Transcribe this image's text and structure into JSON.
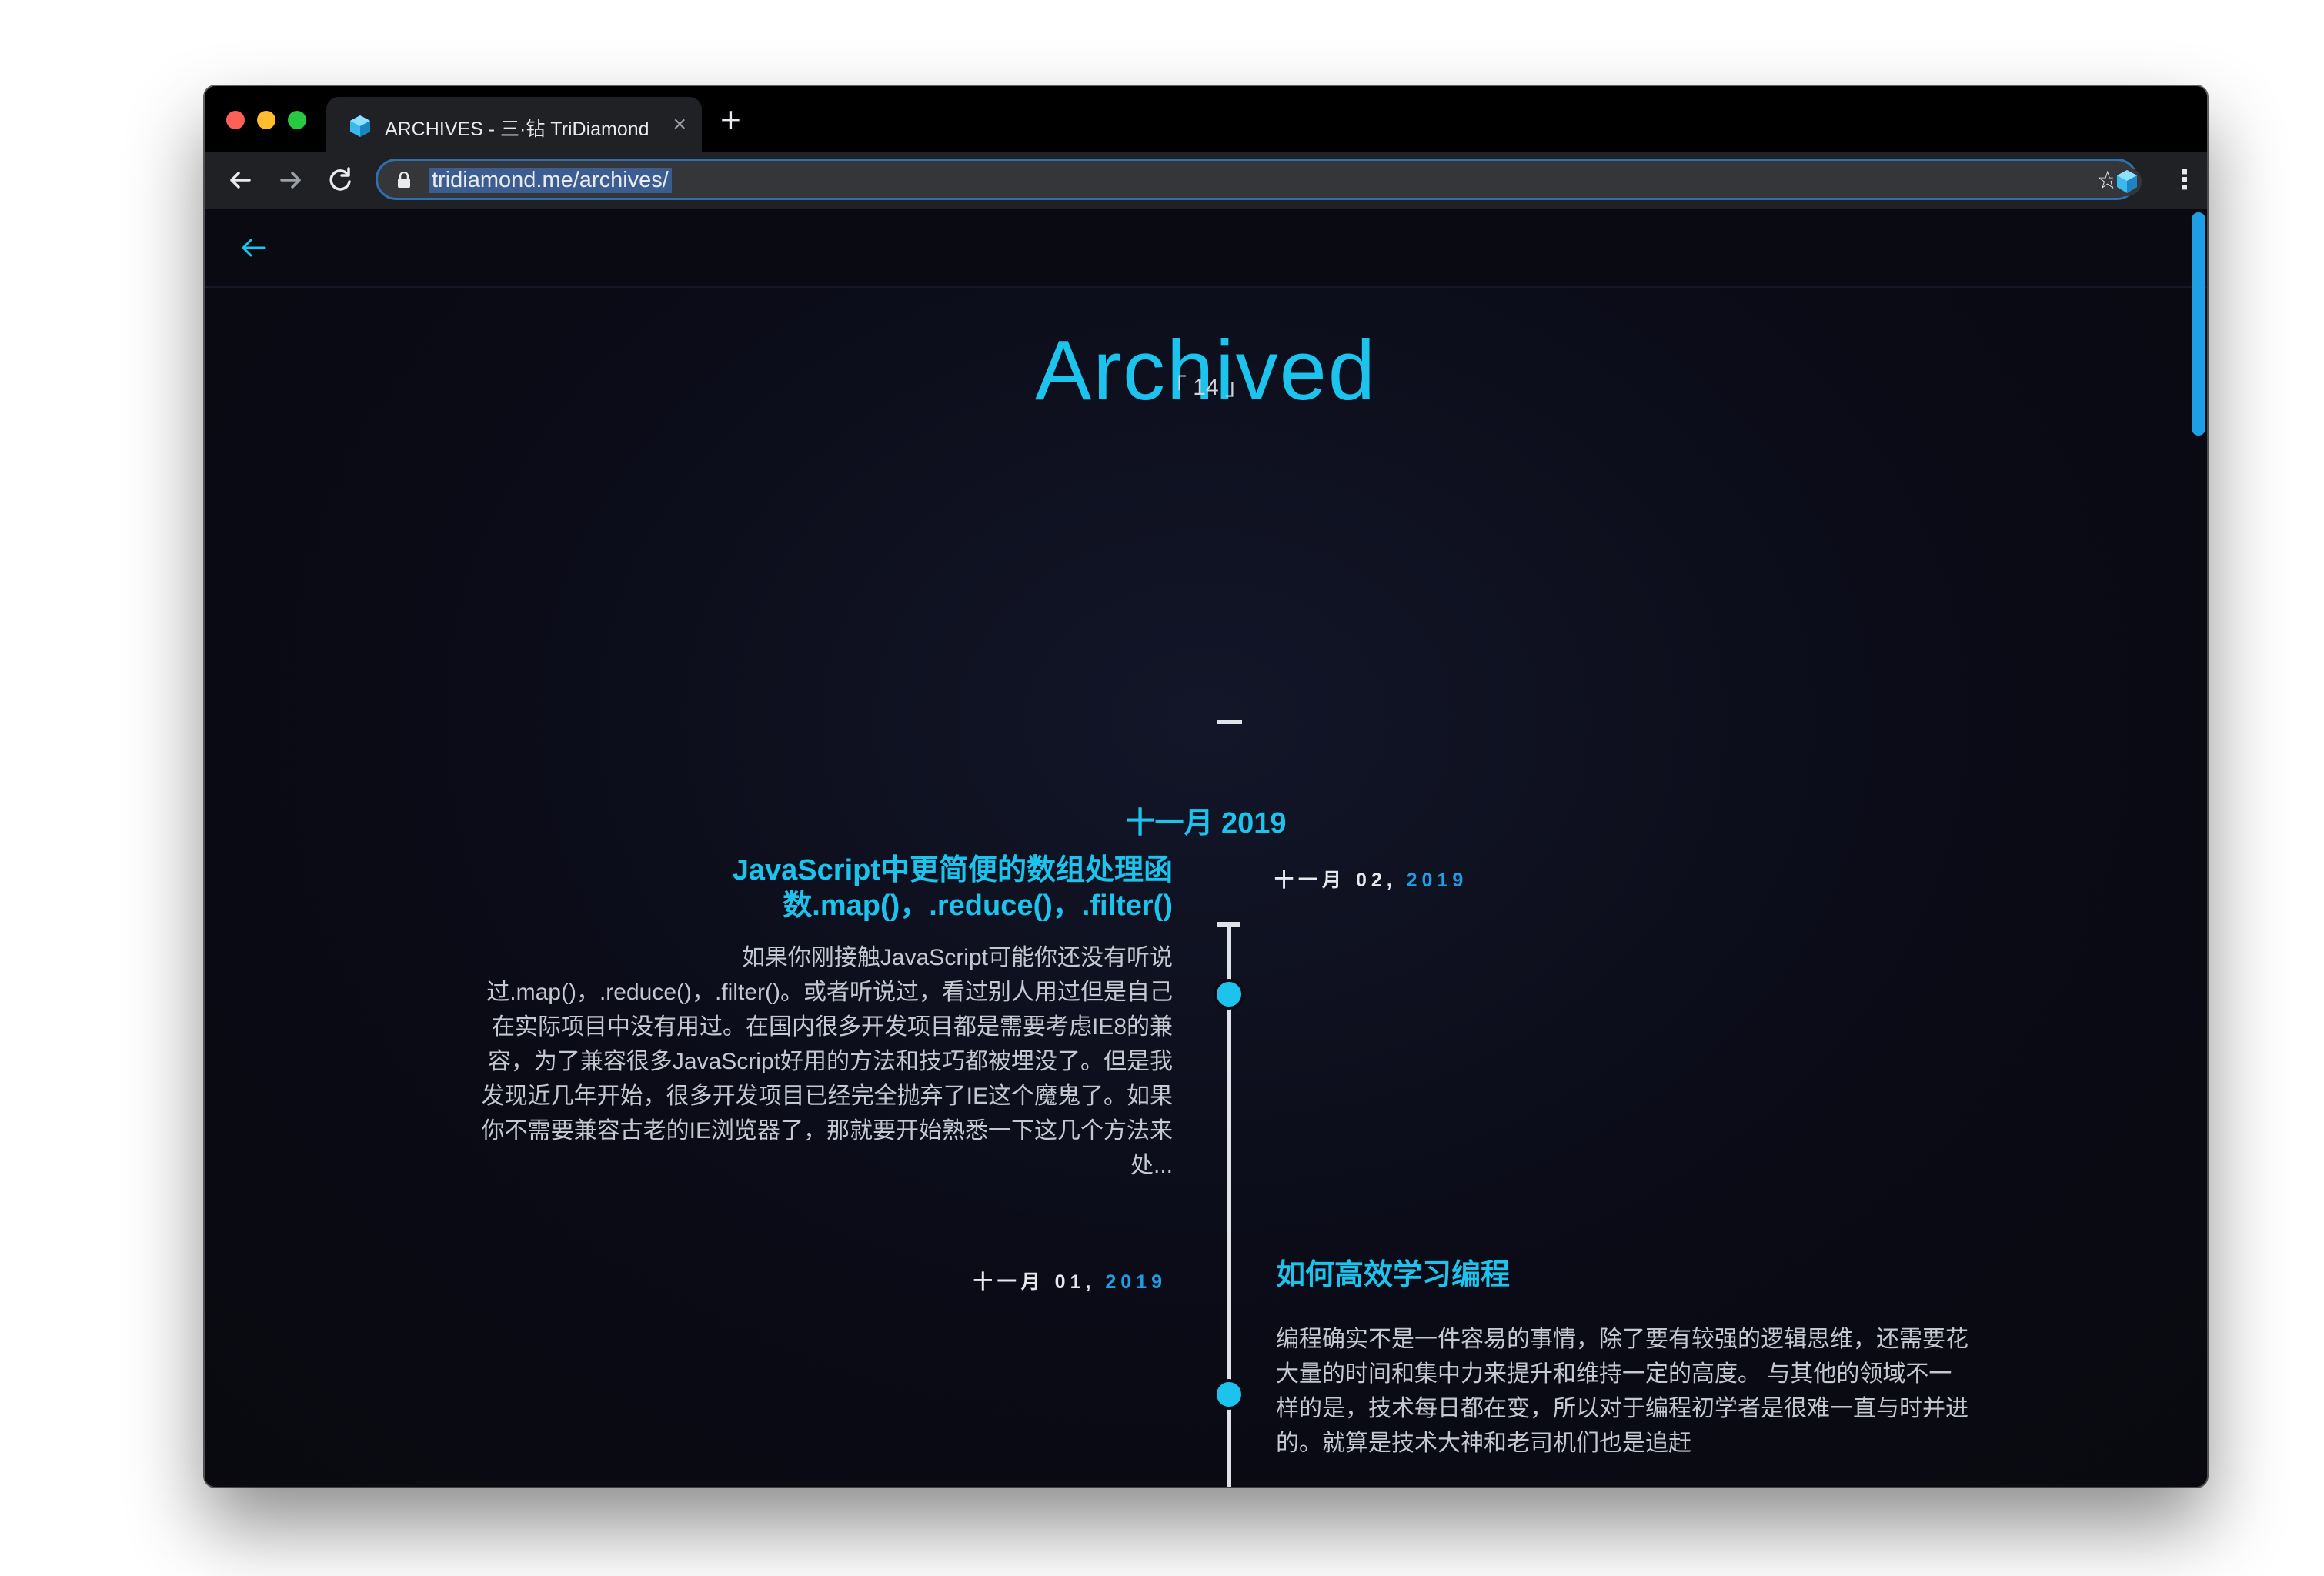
{
  "browser": {
    "tab_title": "ARCHIVES - 三·钻 TriDiamond",
    "tab_close": "×",
    "new_tab": "+",
    "url": "tridiamond.me/archives/"
  },
  "page": {
    "title": "Archived",
    "count": "「 14 」",
    "month": "十一月 2019"
  },
  "posts": [
    {
      "title": "JavaScript中更简便的数组处理函数.map()，.reduce()，.filter()",
      "date_prefix": "十一月 02,",
      "date_year": " 2019",
      "excerpt": "如果你刚接触JavaScript可能你还没有听说过.map()，.reduce()，.filter()。或者听说过，看过别人用过但是自己在实际项目中没有用过。在国内很多开发项目都是需要考虑IE8的兼容，为了兼容很多JavaScript好用的方法和技巧都被埋没了。但是我发现近几年开始，很多开发项目已经完全抛弃了IE这个魔鬼了。如果你不需要兼容古老的IE浏览器了，那就要开始熟悉一下这几个方法来处..."
    },
    {
      "title": "如何高效学习编程",
      "date_prefix": "十一月 01,",
      "date_year": " 2019",
      "excerpt": "编程确实不是一件容易的事情，除了要有较强的逻辑思维，还需要花大量的时间和集中力来提升和维持一定的高度。 与其他的领域不一样的是，技术每日都在变，所以对于编程初学者是很难一直与时并进的。就算是技术大神和老司机们也是追赶"
    }
  ],
  "colors": {
    "accent": "#1cc3ec",
    "page_bg": "#0b0b15"
  }
}
